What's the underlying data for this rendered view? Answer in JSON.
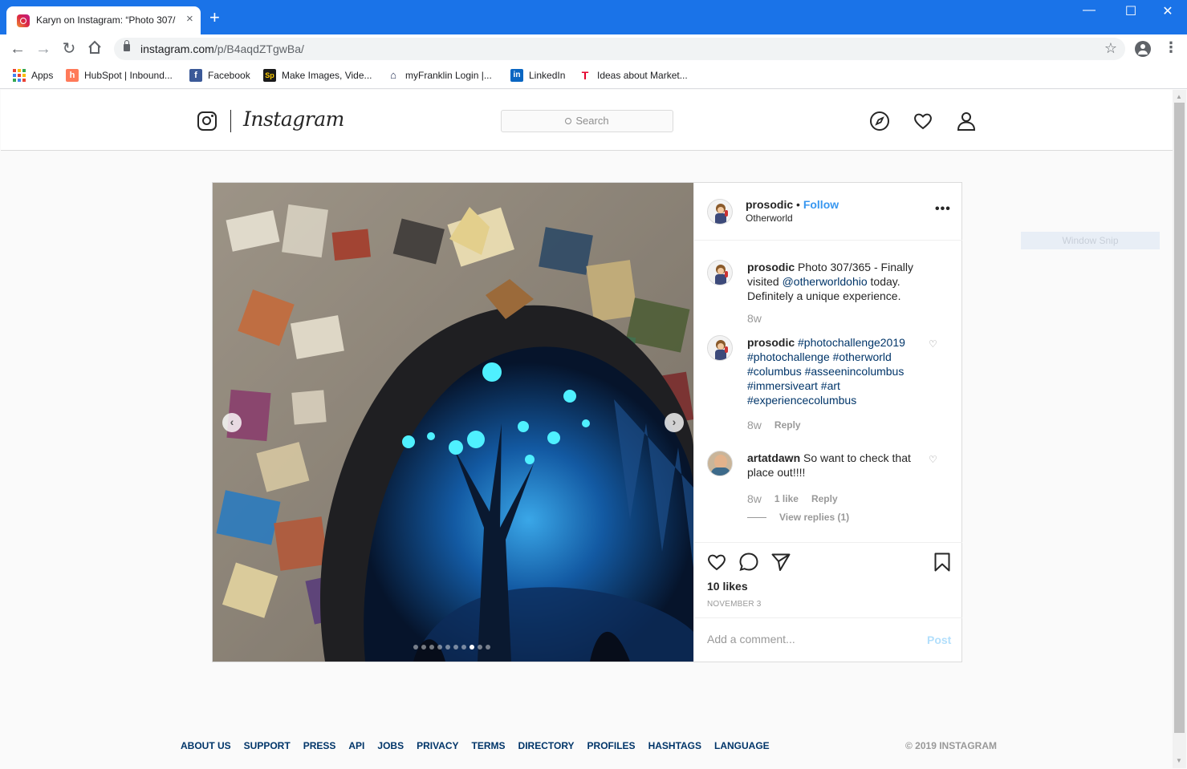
{
  "browser": {
    "tab_title": "Karyn on Instagram: “Photo 307/",
    "tab_close": "×",
    "new_tab": "+",
    "url_host": "instagram.com",
    "url_path": "/p/B4aqdZTgwBa/",
    "window_controls": {
      "minimize": "—",
      "maximize": "☐",
      "close": "✕"
    }
  },
  "bookmarks": [
    {
      "label": "Apps",
      "icon": "apps-grid-icon"
    },
    {
      "label": "HubSpot | Inbound...",
      "icon": "hubspot-icon",
      "color": "#ff7a59",
      "glyph": "h"
    },
    {
      "label": "Facebook",
      "icon": "facebook-icon",
      "color": "#3b5998",
      "glyph": "f"
    },
    {
      "label": "Make Images, Vide...",
      "icon": "spark-icon",
      "color": "#1a1a1a",
      "glyph": "Sp"
    },
    {
      "label": "myFranklin Login |...",
      "icon": "franklin-icon",
      "color": "#ffffff",
      "glyph": "⌂"
    },
    {
      "label": "LinkedIn",
      "icon": "linkedin-icon",
      "color": "#0a66c2",
      "glyph": "in"
    },
    {
      "label": "Ideas about Market...",
      "icon": "t-icon",
      "color": "#ffffff",
      "glyph": "T"
    }
  ],
  "instagram": {
    "wordmark": "Instagram",
    "search_placeholder": "Search"
  },
  "post": {
    "username": "prosodic",
    "separator": " • ",
    "follow": "Follow",
    "location": "Otherworld",
    "more": "•••",
    "caption": {
      "username": "prosodic",
      "text_before": " Photo 307/365 - Finally visited ",
      "mention": "@otherworldohio",
      "text_after": " today. Definitely a unique experience.",
      "age": "8w"
    },
    "comments": [
      {
        "username": "prosodic",
        "hashtags": "#photochallenge2019 #photochallenge #otherworld #columbus #asseenincolumbus #immersiveart #art #experiencecolumbus",
        "age": "8w",
        "reply": "Reply",
        "likes": ""
      },
      {
        "username": "artatdawn",
        "text": " So want to check that place out!!!!",
        "age": "8w",
        "likes": "1 like",
        "reply": "Reply"
      }
    ],
    "view_replies": "View replies (1)",
    "likes": "10 likes",
    "date": "NOVEMBER 3",
    "add_comment_placeholder": "Add a comment...",
    "post_button": "Post",
    "carousel": {
      "count": 10,
      "active": 7
    }
  },
  "footer": {
    "links": [
      "ABOUT US",
      "SUPPORT",
      "PRESS",
      "API",
      "JOBS",
      "PRIVACY",
      "TERMS",
      "DIRECTORY",
      "PROFILES",
      "HASHTAGS",
      "LANGUAGE"
    ],
    "copyright": "© 2019 INSTAGRAM"
  },
  "overlay": {
    "window_snip": "Window Snip"
  },
  "colors": {
    "chrome_blue": "#1a73e8",
    "ig_link": "#003569",
    "follow_blue": "#3897f0"
  }
}
